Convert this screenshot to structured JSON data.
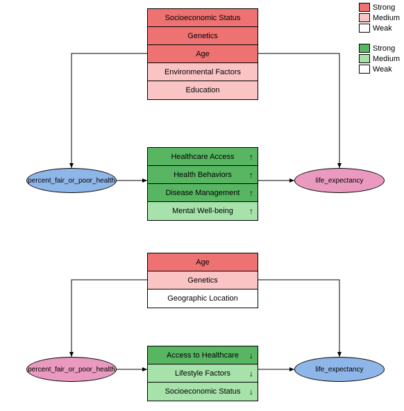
{
  "legend": {
    "red": [
      "Strong",
      "Medium",
      "Weak"
    ],
    "green": [
      "Strong",
      "Medium",
      "Weak"
    ]
  },
  "colors": {
    "red_strong": "#ef7272",
    "red_medium": "#fac4c4",
    "red_weak": "#ffffff",
    "green_strong": "#58b663",
    "green_medium": "#a7e2ab",
    "green_weak": "#ffffff",
    "ellipse_blue": "#8fb6e8",
    "ellipse_pink": "#ea9abf"
  },
  "groups": [
    {
      "confounders": [
        {
          "label": "Socioeconomic Status",
          "strength": "strong"
        },
        {
          "label": "Genetics",
          "strength": "strong"
        },
        {
          "label": "Age",
          "strength": "strong"
        },
        {
          "label": "Environmental Factors",
          "strength": "medium"
        },
        {
          "label": "Education",
          "strength": "medium"
        }
      ],
      "mediators": [
        {
          "label": "Healthcare Access",
          "strength": "strong",
          "direction": "up"
        },
        {
          "label": "Health Behaviors",
          "strength": "strong",
          "direction": "up"
        },
        {
          "label": "Disease Management",
          "strength": "strong",
          "direction": "up"
        },
        {
          "label": "Mental Well-being",
          "strength": "medium",
          "direction": "up"
        }
      ],
      "left_node": {
        "label": "percent_fair_or_poor_health",
        "color": "blue"
      },
      "right_node": {
        "label": "life_expectancy",
        "color": "pink"
      }
    },
    {
      "confounders": [
        {
          "label": "Age",
          "strength": "strong"
        },
        {
          "label": "Genetics",
          "strength": "medium"
        },
        {
          "label": "Geographic Location",
          "strength": "weak"
        }
      ],
      "mediators": [
        {
          "label": "Access to Healthcare",
          "strength": "strong",
          "direction": "down"
        },
        {
          "label": "Lifestyle Factors",
          "strength": "medium",
          "direction": "down"
        },
        {
          "label": "Socioeconomic Status",
          "strength": "medium",
          "direction": "down"
        }
      ],
      "left_node": {
        "label": "percent_fair_or_poor_health",
        "color": "pink"
      },
      "right_node": {
        "label": "life_expectancy",
        "color": "blue"
      }
    }
  ]
}
